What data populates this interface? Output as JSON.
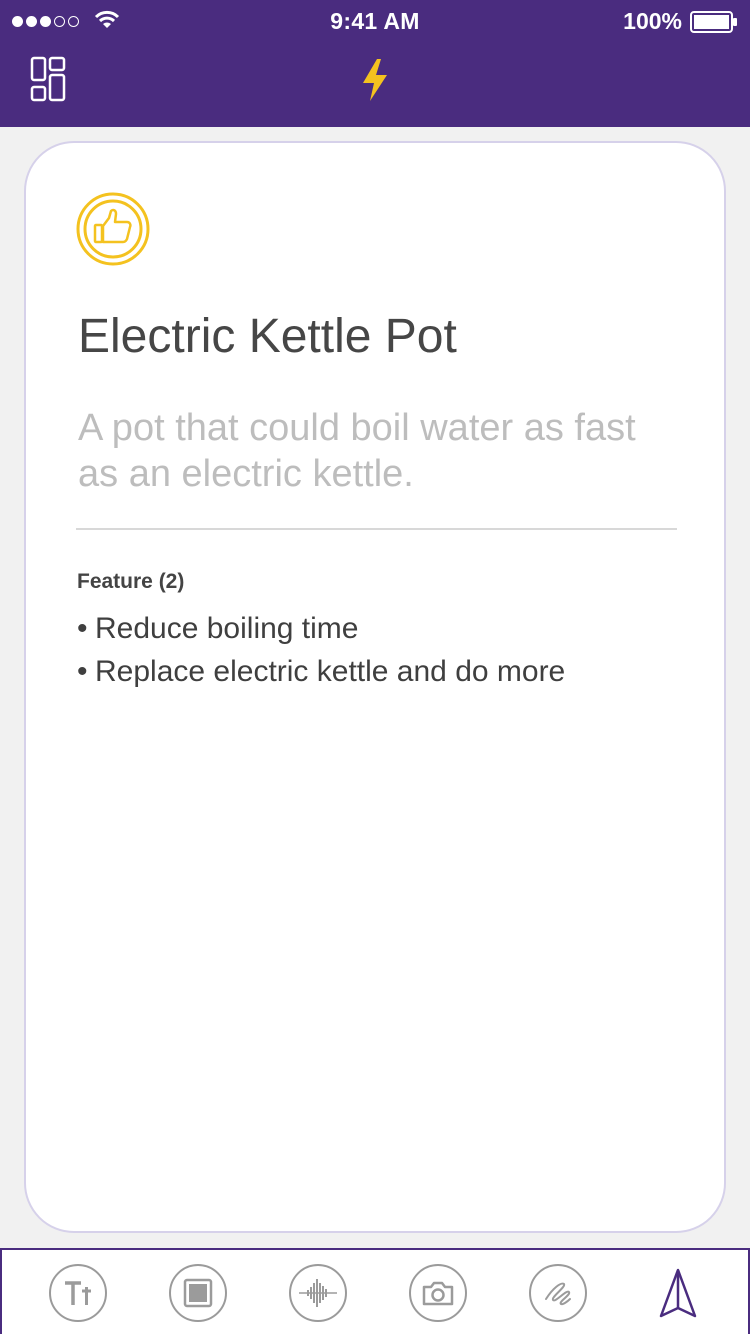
{
  "status_bar": {
    "time": "9:41 AM",
    "battery": "100%",
    "signal_bars_filled": 3,
    "signal_bars_total": 5
  },
  "nav": {
    "left_icon": "layout-grid-icon",
    "center_icon": "lightning-bolt-icon"
  },
  "card": {
    "badge_icon": "thumbs-up-icon",
    "title": "Electric Kettle Pot",
    "description": "A pot that could boil water as fast as an electric kettle.",
    "feature_heading": "Feature (2)",
    "features": [
      "Reduce boiling time",
      "Replace electric kettle and do more"
    ]
  },
  "toolbar": {
    "items": [
      "text-format-icon",
      "image-icon",
      "audio-waveform-icon",
      "camera-icon",
      "sketch-icon",
      "send-icon"
    ]
  },
  "colors": {
    "header_bg": "#4a2c7f",
    "accent_yellow": "#f4c21f",
    "title_text": "#464646",
    "description_text": "#bdbdbd"
  }
}
